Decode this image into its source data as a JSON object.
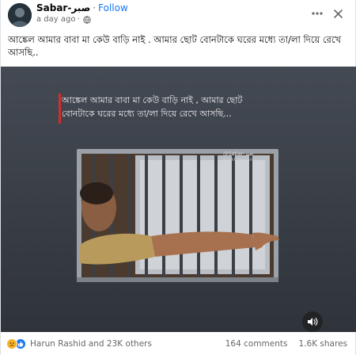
{
  "post": {
    "author": "Sabar-صبر",
    "separator": "·",
    "follow_label": "Follow",
    "timestamp": "a day ago",
    "timestamp_separator": "·",
    "caption": "আঙ্কেল আমার বাবা মা কেউ বাড়ি নাই . আমার ছোট বোনটাকে ঘরের মধ্যে তা/লা দিয়ে রেখে আসছি..",
    "more_icon": "more-dots-icon",
    "close_icon": "close-icon"
  },
  "media": {
    "overlay_line1": "আঙ্কেল আমার বাবা মা কেউ বাড়ি নাই , আমার ছোট",
    "overlay_line2": "বোনটাকে ঘরের মধ্যে তা/লা দিয়ে রেখে আসছি...",
    "watermark": "@Sabar-صبر",
    "watermark_sub": "Sheikh Hossain",
    "sound_icon": "speaker-icon",
    "accent_color": "#d92b2b"
  },
  "footer": {
    "reaction_icons": [
      "sad-reaction-icon",
      "like-reaction-icon"
    ],
    "reactors": "Harun Rashid and 23K others",
    "comments": "164 comments",
    "shares": "1.6K shares"
  }
}
